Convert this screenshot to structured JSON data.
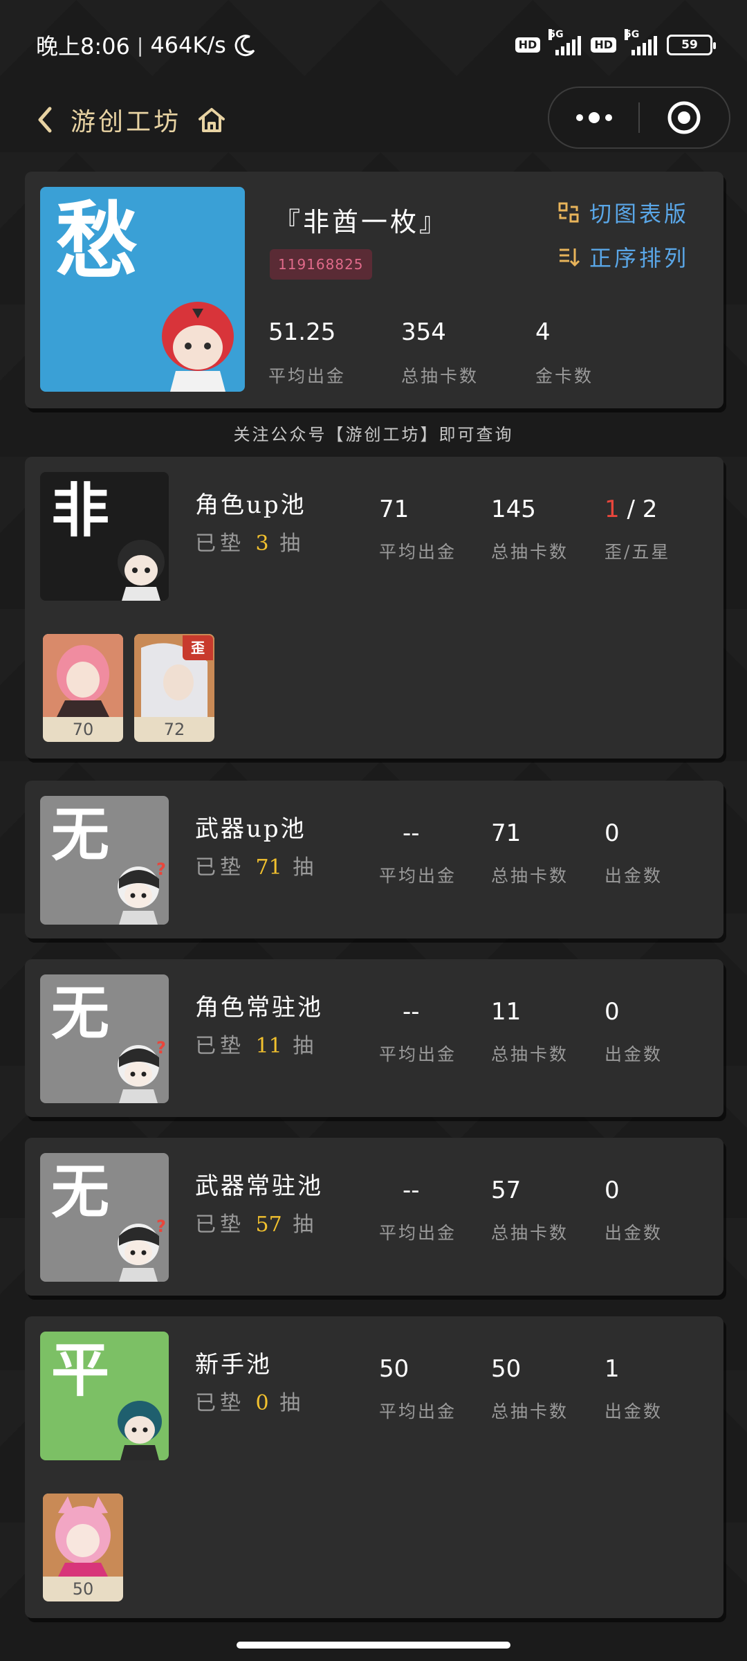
{
  "status_bar": {
    "time": "晚上8:06",
    "separator": "|",
    "net_speed": "464K/s",
    "hd1": "HD",
    "hd2": "HD",
    "g5a": "5G",
    "g5b": "5G",
    "battery": "59"
  },
  "nav": {
    "title": "游创工坊"
  },
  "profile": {
    "avatar_char": "愁",
    "avatar_bg": "#3aa0d6",
    "name": "『非酋一枚』",
    "uid": "119168825",
    "switch_label": "切图表版",
    "sort_label": "正序排列",
    "stats": [
      {
        "value": "51.25",
        "label": "平均出金"
      },
      {
        "value": "354",
        "label": "总抽卡数"
      },
      {
        "value": "4",
        "label": "金卡数"
      }
    ]
  },
  "notice": "关注公众号【游创工坊】即可查询",
  "pools": [
    {
      "avatar_char": "非",
      "avatar_bg": "#1c1c1c",
      "name": "角色up池",
      "pity_prefix": "已垫",
      "pity": "3",
      "pity_suffix": "抽",
      "avg": "71",
      "avg_label": "平均出金",
      "total": "145",
      "total_label": "总抽卡数",
      "third_label": "歪/五星",
      "ratio_red": "1",
      "ratio_sep": " / ",
      "ratio_rest": "2",
      "items": [
        {
          "count": "70",
          "tag": ""
        },
        {
          "count": "72",
          "tag": "歪"
        }
      ]
    },
    {
      "avatar_char": "无",
      "avatar_bg": "#8a8a8a",
      "name": "武器up池",
      "pity_prefix": "已垫",
      "pity": "71",
      "pity_suffix": "抽",
      "avg": "--",
      "avg_label": "平均出金",
      "total": "71",
      "total_label": "总抽卡数",
      "third": "0",
      "third_label": "出金数"
    },
    {
      "avatar_char": "无",
      "avatar_bg": "#8a8a8a",
      "name": "角色常驻池",
      "pity_prefix": "已垫",
      "pity": "11",
      "pity_suffix": "抽",
      "avg": "--",
      "avg_label": "平均出金",
      "total": "11",
      "total_label": "总抽卡数",
      "third": "0",
      "third_label": "出金数"
    },
    {
      "avatar_char": "无",
      "avatar_bg": "#8a8a8a",
      "name": "武器常驻池",
      "pity_prefix": "已垫",
      "pity": "57",
      "pity_suffix": "抽",
      "avg": "--",
      "avg_label": "平均出金",
      "total": "57",
      "total_label": "总抽卡数",
      "third": "0",
      "third_label": "出金数"
    },
    {
      "avatar_char": "平",
      "avatar_bg": "#7cc065",
      "name": "新手池",
      "pity_prefix": "已垫",
      "pity": "0",
      "pity_suffix": "抽",
      "avg": "50",
      "avg_label": "平均出金",
      "total": "50",
      "total_label": "总抽卡数",
      "third": "1",
      "third_label": "出金数",
      "items": [
        {
          "count": "50",
          "tag": ""
        }
      ]
    }
  ],
  "colors": {
    "accent_gold": "#e8d3a3",
    "link_blue": "#5aa7e8",
    "pity_yellow": "#f2c12e",
    "highlight_red": "#e8463c"
  }
}
